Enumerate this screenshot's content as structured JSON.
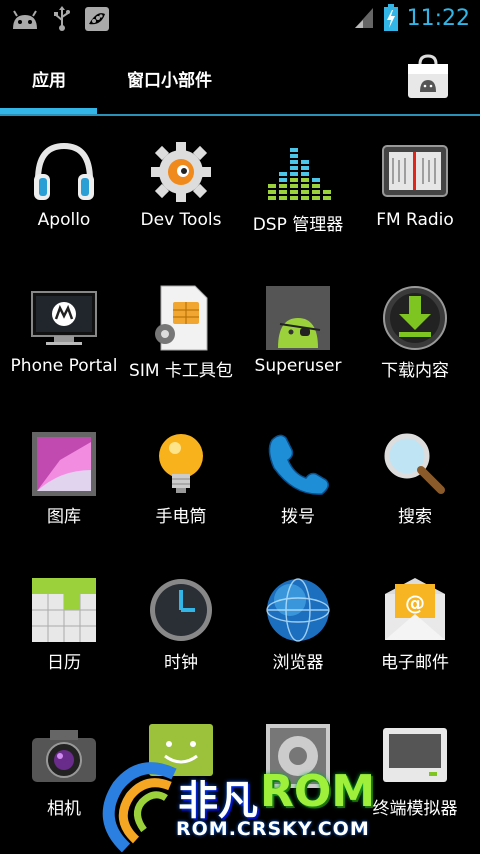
{
  "status_bar": {
    "time": "11:22",
    "left_icons": [
      "android-icon",
      "usb-icon",
      "pea-pod-icon"
    ],
    "right_icons": [
      "signal-icon",
      "battery-charging-icon"
    ]
  },
  "tabs": {
    "apps": "应用",
    "widgets": "窗口小部件",
    "store_icon": "play-store-bag-icon"
  },
  "apps": [
    {
      "label": "Apollo",
      "icon": "headphones-icon"
    },
    {
      "label": "Dev Tools",
      "icon": "gear-icon"
    },
    {
      "label": "DSP 管理器",
      "icon": "equalizer-icon"
    },
    {
      "label": "FM Radio",
      "icon": "radio-icon"
    },
    {
      "label": "Phone Portal",
      "icon": "monitor-icon"
    },
    {
      "label": "SIM 卡工具包",
      "icon": "sim-card-icon"
    },
    {
      "label": "Superuser",
      "icon": "android-pirate-icon"
    },
    {
      "label": "下载内容",
      "icon": "download-icon"
    },
    {
      "label": "图库",
      "icon": "gallery-icon"
    },
    {
      "label": "手电筒",
      "icon": "lightbulb-icon"
    },
    {
      "label": "拨号",
      "icon": "phone-handset-icon"
    },
    {
      "label": "搜索",
      "icon": "magnifier-icon"
    },
    {
      "label": "日历",
      "icon": "calendar-icon"
    },
    {
      "label": "时钟",
      "icon": "clock-icon"
    },
    {
      "label": "浏览器",
      "icon": "globe-icon"
    },
    {
      "label": "电子邮件",
      "icon": "email-icon"
    },
    {
      "label": "相机",
      "icon": "camera-icon"
    },
    {
      "label": "",
      "icon": "messaging-icon"
    },
    {
      "label": "",
      "icon": "settings-icon"
    },
    {
      "label": "终端模拟器",
      "icon": "terminal-icon"
    }
  ],
  "watermark": {
    "title_cn": "非凡",
    "title_en": "ROM",
    "url": "ROM.CRSKY.COM"
  },
  "colors": {
    "accent": "#33b5e5",
    "background": "#000000"
  }
}
